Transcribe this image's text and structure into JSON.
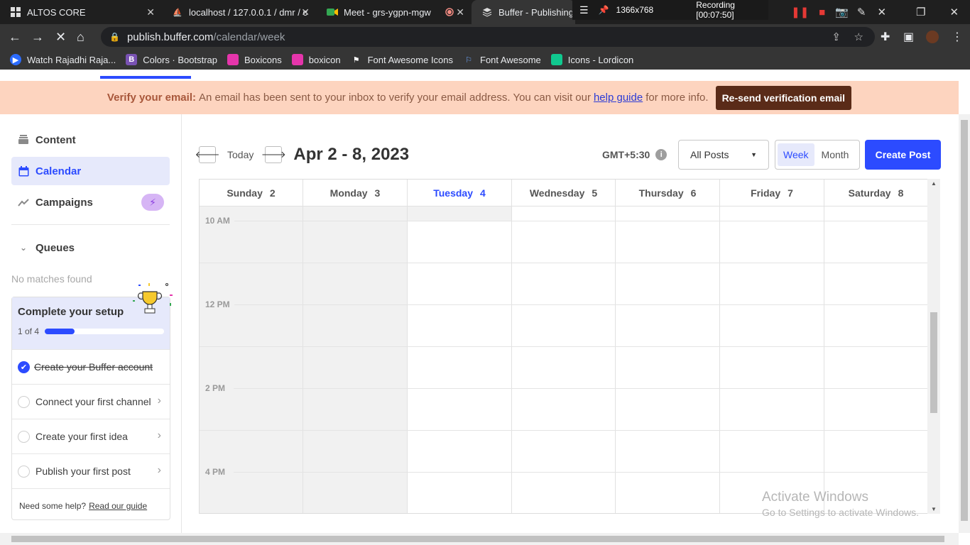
{
  "browser": {
    "tabs": [
      {
        "title": "ALTOS CORE",
        "icon": "grid-icon"
      },
      {
        "title": "localhost / 127.0.0.1 / dmr / c",
        "icon": "phpmyadmin-icon"
      },
      {
        "title": "Meet - grs-ygpn-mgw",
        "icon": "meet-icon"
      },
      {
        "title": "",
        "icon": "record-icon"
      },
      {
        "title": "Buffer - Publishing",
        "icon": "buffer-icon"
      }
    ],
    "recorder": {
      "size": "1366x768",
      "status": "Recording [00:07:50]"
    },
    "url_host": "publish.buffer.com",
    "url_path": "/calendar/week",
    "bookmarks": [
      "Watch Rajadhi Raja...",
      "Colors · Bootstrap",
      "Boxicons",
      "boxicon",
      "Font Awesome Icons",
      "Font Awesome",
      "Icons - Lordicon"
    ]
  },
  "banner": {
    "title": "Verify your email:",
    "text": "An email has been sent to your inbox to verify your email address. You can visit our",
    "link": "help guide",
    "after": "for more info.",
    "button": "Re-send verification email"
  },
  "sidebar": {
    "content": "Content",
    "calendar": "Calendar",
    "campaigns": "Campaigns",
    "queues": "Queues",
    "no_matches": "No matches found",
    "setup_title": "Complete your setup",
    "progress_label": "1 of 4",
    "progress": 0.25,
    "steps": [
      {
        "label": "Create your Buffer account",
        "done": true
      },
      {
        "label": "Connect your first channel",
        "done": false
      },
      {
        "label": "Create your first idea",
        "done": false
      },
      {
        "label": "Publish your first post",
        "done": false
      }
    ],
    "help_text": "Need some help?",
    "help_link": "Read our guide"
  },
  "toolbar": {
    "today": "Today",
    "range": "Apr 2 - 8, 2023",
    "timezone": "GMT+5:30",
    "filter": "All Posts",
    "week": "Week",
    "month": "Month",
    "create": "Create Post"
  },
  "calendar": {
    "days": [
      {
        "name": "Sunday",
        "date": "2"
      },
      {
        "name": "Monday",
        "date": "3"
      },
      {
        "name": "Tuesday",
        "date": "4"
      },
      {
        "name": "Wednesday",
        "date": "5"
      },
      {
        "name": "Thursday",
        "date": "6"
      },
      {
        "name": "Friday",
        "date": "7"
      },
      {
        "name": "Saturday",
        "date": "8"
      }
    ],
    "today": "Tuesday",
    "times": [
      "10 AM",
      "12 PM",
      "2 PM",
      "4 PM"
    ]
  },
  "watermark": {
    "title": "Activate Windows",
    "sub": "Go to Settings to activate Windows."
  }
}
